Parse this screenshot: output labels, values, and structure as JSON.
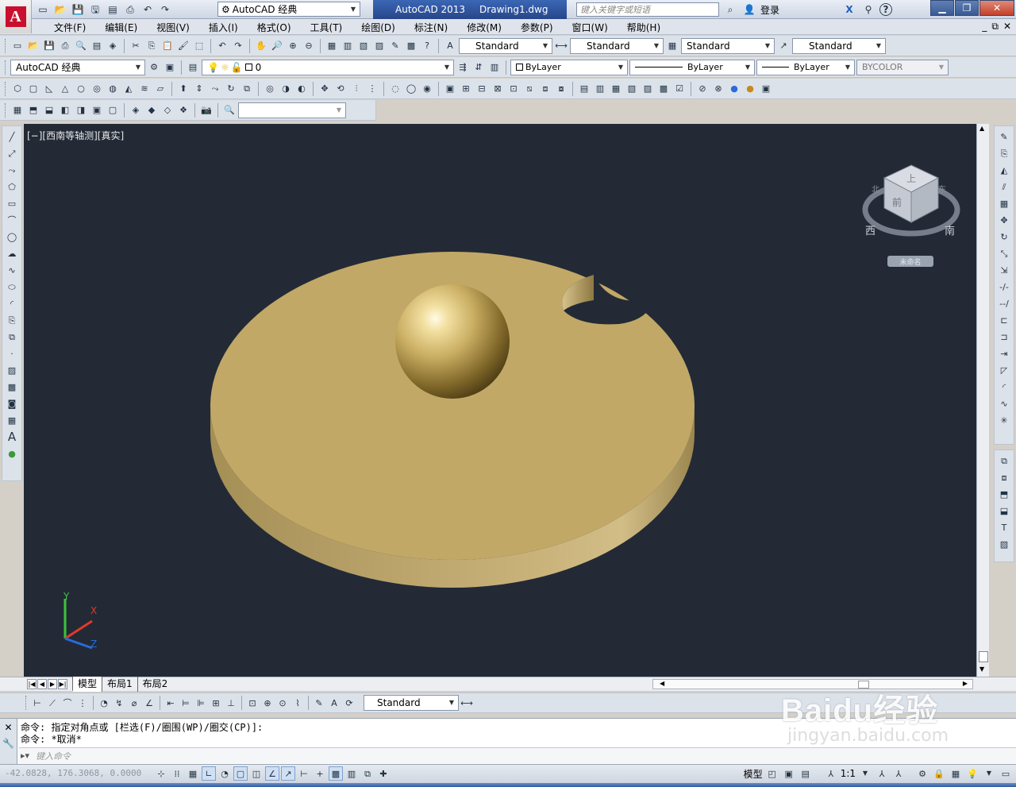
{
  "window": {
    "app_title": "AutoCAD 2013",
    "document": "Drawing1.dwg",
    "workspace": "AutoCAD 经典",
    "search_placeholder": "键入关键字或短语",
    "login": "登录",
    "help": "?"
  },
  "menu": {
    "items": [
      "文件(F)",
      "编辑(E)",
      "视图(V)",
      "插入(I)",
      "格式(O)",
      "工具(T)",
      "绘图(D)",
      "标注(N)",
      "修改(M)",
      "参数(P)",
      "窗口(W)",
      "帮助(H)"
    ],
    "doc_controls": [
      "_",
      "⧉",
      "✕"
    ]
  },
  "styles_toolbar": {
    "text_style": "Standard",
    "dim_style": "Standard",
    "table_style": "Standard",
    "mleader_style": "Standard"
  },
  "layers_toolbar": {
    "workspace": "AutoCAD 经典",
    "layer": "0",
    "color": "ByLayer",
    "linetype": "ByLayer",
    "lineweight": "ByLayer",
    "plotstyle": "BYCOLOR"
  },
  "viewport": {
    "label": "[−][西南等轴测][真实]",
    "background": "#232a36",
    "viewcube": {
      "top_face": "上",
      "left_face": "前",
      "compass_w": "西",
      "compass_s": "南",
      "compass_n": "北",
      "compass_e": "东",
      "wcs": "未命名"
    },
    "ucs": {
      "x": "X",
      "y": "Y",
      "z": "Z"
    }
  },
  "tabs": {
    "items": [
      "模型",
      "布局1",
      "布局2"
    ],
    "active": "模型"
  },
  "dim_toolbar": {
    "dim_style": "Standard"
  },
  "command": {
    "line1": "命令: 指定对角点或 [栏选(F)/圈围(WP)/圈交(CP)]:",
    "line2": "命令: *取消*",
    "prompt_placeholder": "键入命令"
  },
  "status": {
    "coords": "-42.0828, 176.3068, 0.0000",
    "model": "模型",
    "scale": "1:1"
  },
  "watermark": {
    "brand": "Baidu经验",
    "url": "jingyan.baidu.com"
  },
  "colors": {
    "solid": "#c2a866",
    "titlebar": "#3b67b5",
    "x_axis": "#e03a2a",
    "y_axis": "#3cc43a",
    "z_axis": "#2a6bd8"
  }
}
